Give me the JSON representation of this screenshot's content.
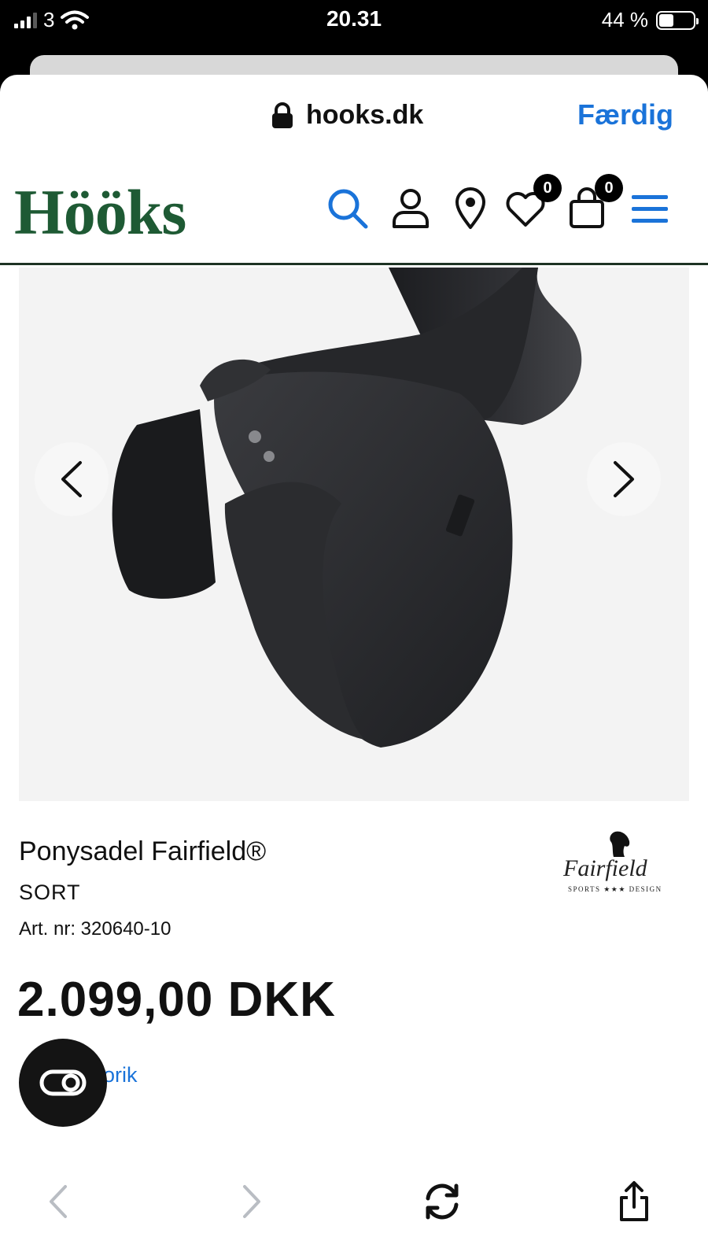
{
  "status_bar": {
    "carrier": "3",
    "time": "20.31",
    "battery": "44 %",
    "battery_level": 0.44
  },
  "browser": {
    "url": "hooks.dk",
    "done_label": "Færdig"
  },
  "site": {
    "logo": "Hööks",
    "wishlist_count": "0",
    "cart_count": "0"
  },
  "product": {
    "title": "Ponysadel Fairfield®",
    "color": "SORT",
    "sku": "Art. nr: 320640-10",
    "price": "2.099,00 DKK",
    "history_link": "storik"
  },
  "brand": {
    "name": "Fairfield",
    "tagline": "SPORTS ★★★ DESIGN"
  },
  "colors": {
    "accent": "#1a73d9",
    "logo_green": "#1e5a34"
  },
  "icons": [
    "lock-icon",
    "search-icon",
    "user-icon",
    "location-icon",
    "heart-icon",
    "bag-icon",
    "menu-icon",
    "chevron-left-icon",
    "chevron-right-icon",
    "toggle-icon",
    "back-icon",
    "forward-icon",
    "reload-icon",
    "share-icon"
  ]
}
